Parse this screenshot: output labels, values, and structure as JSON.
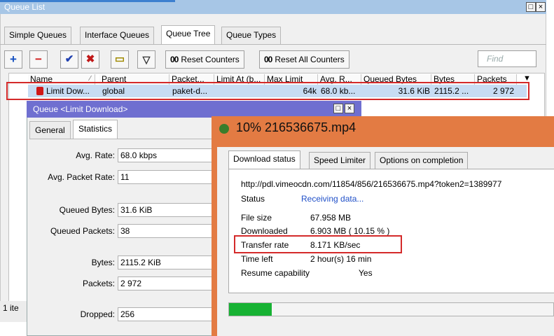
{
  "queue_list": {
    "title": "Queue List",
    "tabs": [
      "Simple Queues",
      "Interface Queues",
      "Queue Tree",
      "Queue Types"
    ],
    "toolbar": {
      "add": "+",
      "remove": "−",
      "enable": "✔",
      "disable": "✖",
      "comment": "▭",
      "filter": "▽"
    },
    "reset_counters": {
      "prefix": "00",
      "label": "Reset Counters"
    },
    "reset_all_counters": {
      "prefix": "00",
      "label": "Reset All Counters"
    },
    "find_placeholder": "Find",
    "columns": [
      "Name",
      "Parent",
      "Packet...",
      "Limit At (b...",
      "Max Limit",
      "Avg. R...",
      "Queued Bytes",
      "Bytes",
      "Packets"
    ],
    "row": {
      "name": "Limit Dow...",
      "parent": "global",
      "packet_mark": "paket-d...",
      "limit_at": "",
      "max_limit": "64k",
      "avg_rate": "68.0 kb...",
      "queued_bytes": "31.6 KiB",
      "bytes": "2115.2 ...",
      "packets": "2 972"
    },
    "status": "1 ite"
  },
  "queue_dialog": {
    "title": "Queue <Limit Download>",
    "tabs": [
      "General",
      "Statistics"
    ],
    "fields": {
      "avg_rate": {
        "label": "Avg. Rate:",
        "value": "68.0 kbps"
      },
      "avg_packet_rate": {
        "label": "Avg. Packet Rate:",
        "value": "11"
      },
      "queued_bytes": {
        "label": "Queued Bytes:",
        "value": "31.6 KiB"
      },
      "queued_packets": {
        "label": "Queued Packets:",
        "value": "38"
      },
      "bytes": {
        "label": "Bytes:",
        "value": "2115.2 KiB"
      },
      "packets": {
        "label": "Packets:",
        "value": "2 972"
      },
      "dropped": {
        "label": "Dropped:",
        "value": "256"
      }
    }
  },
  "download": {
    "title": "10% 216536675.mp4",
    "tabs": [
      "Download status",
      "Speed Limiter",
      "Options on completion"
    ],
    "url": "http://pdl.vimeocdn.com/11854/856/216536675.mp4?token2=1389977",
    "status": {
      "label": "Status",
      "value": "Receiving data..."
    },
    "file_size": {
      "label": "File size",
      "value": "67.958  MB"
    },
    "downloaded": {
      "label": "Downloaded",
      "value": "6.903  MB  ( 10.15 % )"
    },
    "transfer_rate": {
      "label": "Transfer rate",
      "value": "8.171  KB/sec"
    },
    "time_left": {
      "label": "Time left",
      "value": "2 hour(s) 16 min"
    },
    "resume": {
      "label": "Resume capability",
      "value": "Yes"
    },
    "progress": 0.1015,
    "colors": {
      "progress": "#17b233",
      "title_bar": "#e37b43",
      "highlight": "#d42a2a"
    }
  }
}
